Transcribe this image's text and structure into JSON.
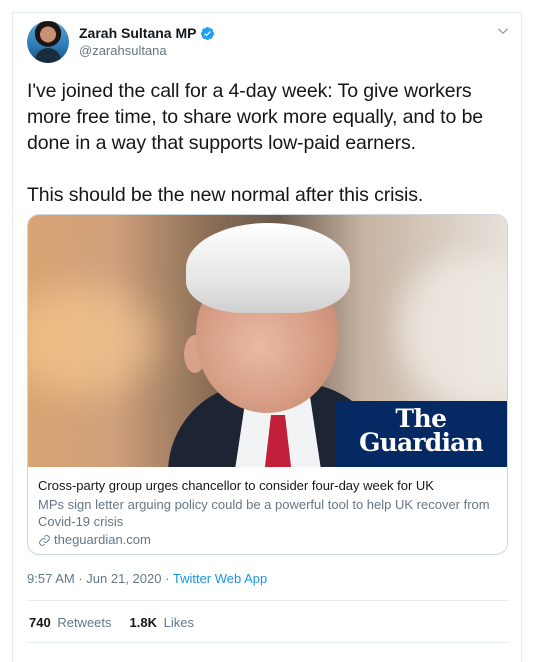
{
  "author": {
    "display_name": "Zarah Sultana MP",
    "handle": "@zarahsultana"
  },
  "tweet": {
    "lines": [
      "I've joined the call for a 4-day week: To give workers",
      "more free time, to share work more equally, and to be",
      "done in a way that supports low-paid earners."
    ],
    "line2": "This should be the new normal after this crisis."
  },
  "card": {
    "image_brand_line1": "The",
    "image_brand_line2": "Guardian",
    "title": "Cross-party group urges chancellor to consider four-day week for UK",
    "description": "MPs sign letter arguing policy could be a powerful tool to help UK recover from Covid-19 crisis",
    "domain": "theguardian.com"
  },
  "meta": {
    "time": "9:57 AM",
    "date": "Jun 21, 2020",
    "separator": "·",
    "source": "Twitter Web App"
  },
  "stats": {
    "retweets_count": "740",
    "retweets_label": "Retweets",
    "likes_count": "1.8K",
    "likes_label": "Likes"
  },
  "colors": {
    "accent": "#1b95e0",
    "guardian_blue": "#052962",
    "secondary_text": "#657786"
  },
  "icons": [
    "verified-badge-icon",
    "chevron-down-icon",
    "link-icon"
  ]
}
